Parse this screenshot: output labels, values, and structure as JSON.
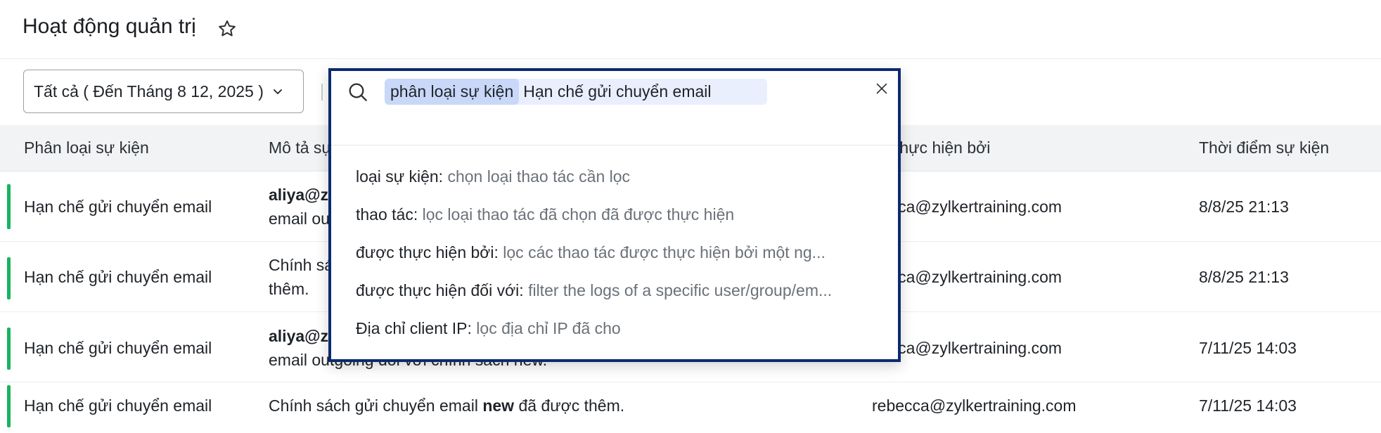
{
  "header": {
    "title": "Hoạt động quản trị"
  },
  "toolbar": {
    "filter_value": "Tất cả ( Đến Tháng 8 12, 2025 )"
  },
  "table": {
    "columns": [
      "Phân loại sự kiện",
      "Mô tả sự",
      "ợc thực hiện bởi",
      "Thời điểm sự kiện"
    ],
    "rows": [
      {
        "category": "Hạn chế gửi chuyển email",
        "desc_bold": "aliya@z",
        "desc_line2": "email ou",
        "actor": "becca@zylkertraining.com",
        "time": "8/8/25 21:13"
      },
      {
        "category": "Hạn chế gửi chuyển email",
        "desc_line1": "Chính sá",
        "desc_line2": "thêm.",
        "actor": "becca@zylkertraining.com",
        "time": "8/8/25 21:13"
      },
      {
        "category": "Hạn chế gửi chuyển email",
        "desc_bold": "aliya@z",
        "desc_line2": "email outgoing đối với chính sách new.",
        "actor": "becca@zylkertraining.com",
        "time": "7/11/25 14:03"
      },
      {
        "category": "Hạn chế gửi chuyển email",
        "desc_a": "Chính sách gửi chuyển email ",
        "desc_b": "new",
        "desc_c": " đã được thêm.",
        "actor": "rebecca@zylkertraining.com",
        "time": "7/11/25 14:03"
      }
    ]
  },
  "search": {
    "token_key": "phân loại sự kiện",
    "token_value": "Hạn chế gửi chuyển email",
    "suggestions": [
      {
        "key": "loại sự kiện:",
        "value": "chọn loại thao tác cần lọc"
      },
      {
        "key": "thao tác:",
        "value": "lọc loại thao tác đã chọn đã được thực hiện"
      },
      {
        "key": "được thực hiện bởi:",
        "value": "lọc các thao tác được thực hiện bởi một ng..."
      },
      {
        "key": "được thực hiện đối với:",
        "value": "filter the logs of a specific user/group/em..."
      },
      {
        "key": "Địa chỉ client IP:",
        "value": "lọc địa chỉ IP đã cho"
      }
    ]
  },
  "icons": {
    "favorite": "star-icon",
    "search": "search-icon",
    "close": "close-icon",
    "dropdown": "chevron-down-icon"
  },
  "colors": {
    "accent_border": "#0b2a6f",
    "status_bar": "#19b35f",
    "token_bg": "#c9d8f8"
  }
}
